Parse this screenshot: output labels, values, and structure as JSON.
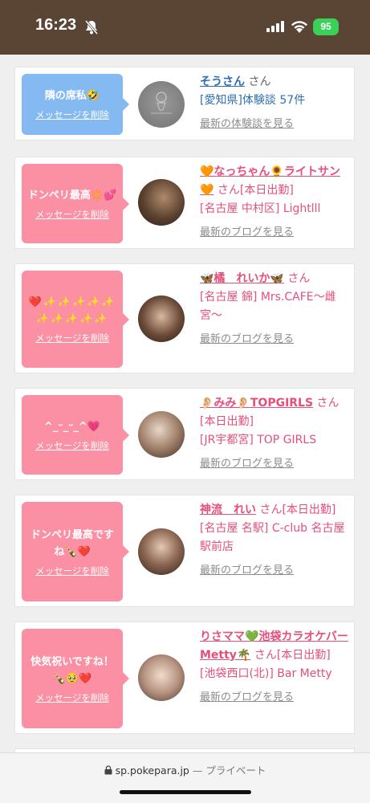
{
  "status": {
    "time": "16:23",
    "battery": "95"
  },
  "cards": [
    {
      "message": "隣の席私🤣",
      "delete_label": "メッセージを削除",
      "name": "そうさん",
      "suffix": "さん",
      "line2": "[愛知県]体験談 57件",
      "latest": "最新の体験談を見る",
      "bubble_color": "#84b9f2",
      "name_color": "#2e6fb3",
      "line2_color": "#2e6fb3"
    },
    {
      "message": "ドンペリ最高🔆💕",
      "delete_label": "メッセージを削除",
      "name": "🧡なっちゃん🌻ライトサン🧡",
      "suffix": "さん[本日出勤]",
      "line2": "[名古屋 中村区] Lightlll",
      "latest": "最新のブログを見る",
      "bubble_color": "#fb8fa3",
      "name_color": "#e64f7a",
      "line2_color": "#e64f7a"
    },
    {
      "message": "❤️✨✨✨✨✨✨✨✨✨✨",
      "delete_label": "メッセージを削除",
      "name": "🦋橘　れいか🦋",
      "suffix": "さん",
      "line2": "[名古屋 錦] Mrs.CAFE〜雌宮〜",
      "latest": "最新のブログを見る",
      "bubble_color": "#fb8fa3",
      "name_color": "#e64f7a",
      "line2_color": "#e64f7a"
    },
    {
      "message": "^_ᵕ_ᵕ_^💗",
      "delete_label": "メッセージを削除",
      "name": "👂🏻みみ👂🏻TOPGIRLS",
      "suffix": "さん[本日出勤]",
      "line2": "[JR宇都宮] TOP GIRLS",
      "latest": "最新のブログを見る",
      "bubble_color": "#fb8fa3",
      "name_color": "#e64f7a",
      "line2_color": "#e64f7a"
    },
    {
      "message": "ドンペリ最高ですね🍾❤️",
      "delete_label": "メッセージを削除",
      "name": "神流　れい",
      "suffix": "さん[本日出勤]",
      "line2": "[名古屋 名駅] C-club 名古屋駅前店",
      "latest": "最新のブログを見る",
      "bubble_color": "#fb8fa3",
      "name_color": "#e64f7a",
      "line2_color": "#e64f7a"
    },
    {
      "message": "快気祝いですね！🍾🥹❤️",
      "delete_label": "メッセージを削除",
      "name": "りさママ💚池袋カラオケバーMetty🌴",
      "suffix": "さん[本日出勤]",
      "line2": "[池袋西口(北)] Bar Metty",
      "latest": "最新のブログを見る",
      "bubble_color": "#fb8fa3",
      "name_color": "#e64f7a",
      "line2_color": "#e64f7a"
    }
  ],
  "browser": {
    "domain": "sp.pokepara.jp",
    "separator": "—",
    "mode": "プライベート"
  }
}
